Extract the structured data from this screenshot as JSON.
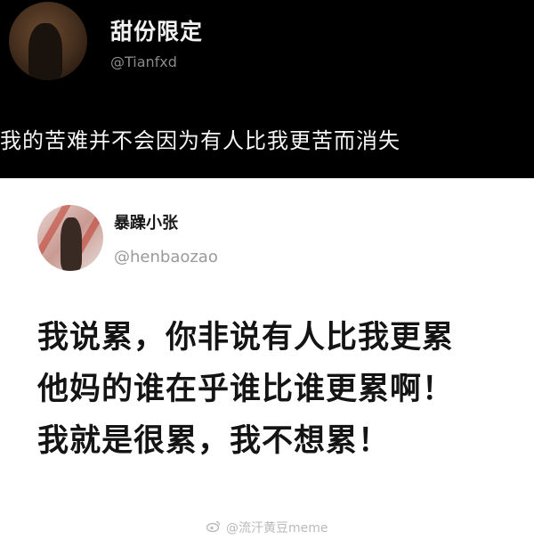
{
  "top_post": {
    "display_name": "甜份限定",
    "handle": "@Tianfxd",
    "text": "我的苦难并不会因为有人比我更苦而消失"
  },
  "inner_post": {
    "display_name": "暴躁小张",
    "handle": "@henbaozao",
    "lines": [
      "我说累，你非说有人比我更累",
      "他妈的谁在乎谁比谁更累啊！",
      "我就是很累，我不想累！"
    ]
  },
  "watermark": {
    "text": "@流汗黄豆meme",
    "icon": "weibo-icon"
  },
  "colors": {
    "dark_bg": "#000000",
    "light_bg": "#ffffff",
    "handle_gray": "#8a8a8a"
  }
}
